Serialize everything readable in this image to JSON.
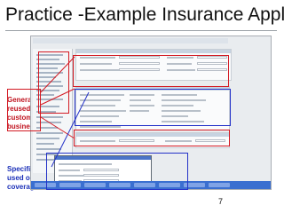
{
  "slide": {
    "title": "Practice -Example Insurance Appl.",
    "page_number": "7"
  },
  "annotations": {
    "general": "General\nreused:\ncustom,\nbusiness",
    "specific": "Specific\nused once:\ncoverage"
  },
  "colors": {
    "general_accent": "#c0121e",
    "specific_accent": "#1a2fb8"
  }
}
